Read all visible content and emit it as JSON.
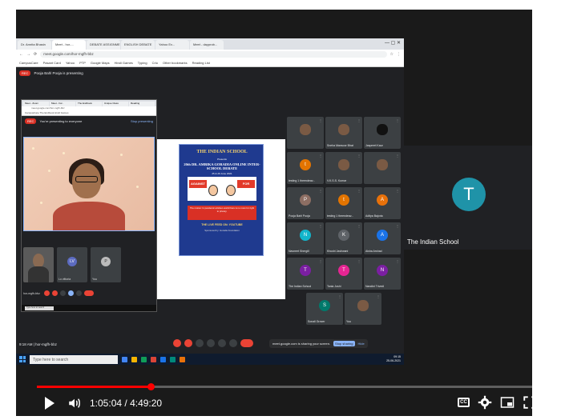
{
  "outer_browser": {
    "tabs": [
      "Dr. Amrita Bhasin",
      "Meet - hor-...",
      "DEBATE ASSIGNMENT",
      "ENGLISH DEBATE",
      "Yahoo Ev...",
      "Meet - dayprob..."
    ],
    "url": "meet.google.com/hor-mgfh-bbz",
    "bookmarks": [
      "CampusCare",
      "Pasant Card",
      "Yahoo",
      "PTP",
      "Google Maps",
      "Hindi Games",
      "Typing",
      "Crio",
      "Other bookmarks",
      "Reading List"
    ]
  },
  "meet": {
    "presenter_banner": "Pooja Bahl Pooja is presenting",
    "rec_label": "REC",
    "time_meeting": "9:18 AM  |  hor-mgfh-bbz",
    "sharing_text": "meet.google.com is sharing your screen.",
    "stop_sharing": "Stop sharing",
    "hide_label": "Hide"
  },
  "inner_window": {
    "tabs": [
      "Meet - Zoom",
      "Meet - hor-",
      "The Endbook",
      "Unique Class",
      "Reading"
    ],
    "url": "meet.google.com/hor-mgfh-bbz",
    "bookmarks": "CampusCare  The Endbook  Hindi Games",
    "banner": "You're presenting to everyone",
    "stop_label": "Stop presenting",
    "mini_tiles": [
      {
        "label": "",
        "avatar": ""
      },
      {
        "label": "Lo vittoria",
        "avatar": "LV"
      },
      {
        "label": "You",
        "avatar": "P"
      }
    ],
    "meeting_code": "hor-mgfh-bbz",
    "search": "Type here to search"
  },
  "poster": {
    "school": "THE INDIAN SCHOOL",
    "presents": "Presents",
    "main": "20th DR. AMBIKA GORADIA ONLINE INTER-SCHOOL DEBATE",
    "date": "25 & 26 June 2021",
    "against": "AGAINST",
    "for": "FOR",
    "motion": "The motion: In pandemic-stricken world there is no room for right to privacy.",
    "live": "THE LIVE FEED ON: YOUTUBE",
    "small": "Sponsored by: Goradia Foundation"
  },
  "participants": [
    {
      "name": "",
      "avatar": "",
      "color": "#7a5a44",
      "video": true
    },
    {
      "name": "Sneha Mansoor Bhat",
      "avatar": "",
      "color": "#7a5a44",
      "video": true
    },
    {
      "name": "Jaspreet Kaur",
      "avatar": "",
      "color": "#111111",
      "video": true
    },
    {
      "name": "testing 1 theendeav...",
      "avatar": "t",
      "color": "#e37400",
      "video": false
    },
    {
      "name": "V.K.S.S. Kumar",
      "avatar": "",
      "color": "#7a5a44",
      "video": true
    },
    {
      "name": "",
      "avatar": "",
      "color": "#7a5a44",
      "video": true
    },
    {
      "name": "Pooja Bahl Pooja",
      "avatar": "P",
      "color": "#8d6e63",
      "video": false
    },
    {
      "name": "testing 1 theendeav...",
      "avatar": "t",
      "color": "#e37400",
      "video": false
    },
    {
      "name": "Aditya Bajoria",
      "avatar": "A",
      "color": "#e8710a",
      "video": false
    },
    {
      "name": "Navneet Shergill",
      "avatar": "N",
      "color": "#12b5cb",
      "video": false
    },
    {
      "name": "Khushi Jashwani",
      "avatar": "K",
      "color": "#5f6368",
      "video": false
    },
    {
      "name": "Aisha Arshad",
      "avatar": "A",
      "color": "#1a73e8",
      "video": false
    },
    {
      "name": "The Indian School",
      "avatar": "T",
      "color": "#7b1fa2",
      "video": false
    },
    {
      "name": "Tania Joshi",
      "avatar": "T",
      "color": "#e52592",
      "video": false
    },
    {
      "name": "Nandini Trivedi",
      "avatar": "N",
      "color": "#7b1fa2",
      "video": false
    },
    {
      "name": "Sonali Grover",
      "avatar": "S",
      "color": "#00796b",
      "video": false
    },
    {
      "name": "You",
      "avatar": "",
      "color": "#7a5a44",
      "video": true
    }
  ],
  "taskbar": {
    "search": "Type here to search",
    "time": "09:15",
    "date": "25-06-2021",
    "lang": "ENG"
  },
  "side_tile": {
    "avatar": "T",
    "name": "The Indian School",
    "color": "#1f93a8"
  },
  "player": {
    "current_time": "1:05:04",
    "separator": " / ",
    "duration": "4:49:20",
    "progress": 0.2247
  }
}
